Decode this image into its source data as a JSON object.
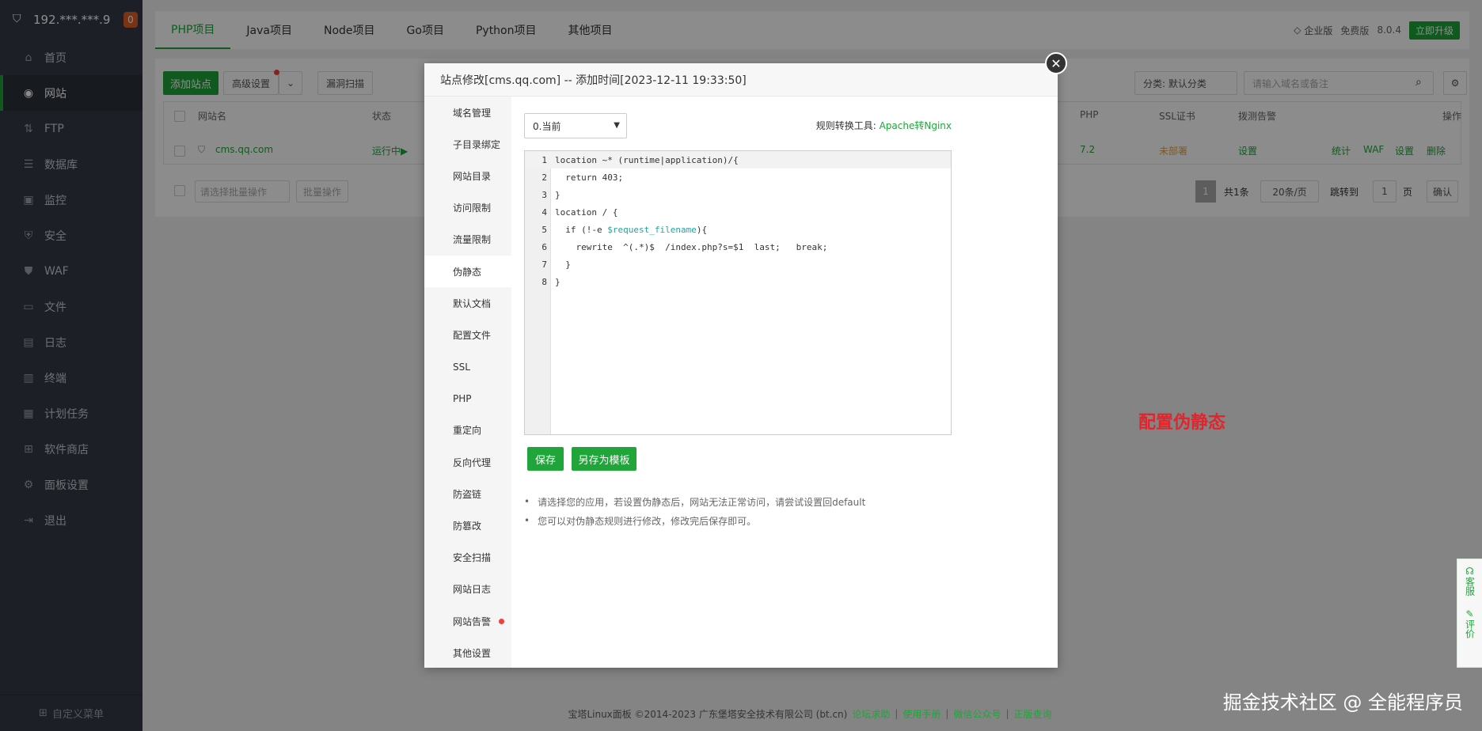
{
  "sidebar": {
    "host": "192.***.***.9",
    "badge": "0",
    "items": [
      {
        "label": "首页",
        "icon": "home-icon"
      },
      {
        "label": "网站",
        "icon": "globe-icon"
      },
      {
        "label": "FTP",
        "icon": "ftp-icon"
      },
      {
        "label": "数据库",
        "icon": "database-icon"
      },
      {
        "label": "监控",
        "icon": "monitor-icon"
      },
      {
        "label": "安全",
        "icon": "security-icon"
      },
      {
        "label": "WAF",
        "icon": "waf-icon"
      },
      {
        "label": "文件",
        "icon": "folder-icon"
      },
      {
        "label": "日志",
        "icon": "log-icon"
      },
      {
        "label": "终端",
        "icon": "terminal-icon"
      },
      {
        "label": "计划任务",
        "icon": "calendar-icon"
      },
      {
        "label": "软件商店",
        "icon": "store-icon"
      },
      {
        "label": "面板设置",
        "icon": "settings-icon"
      },
      {
        "label": "退出",
        "icon": "logout-icon"
      }
    ],
    "custom_menu": "自定义菜单"
  },
  "topbar": {
    "tabs": [
      "PHP项目",
      "Java项目",
      "Node项目",
      "Go项目",
      "Python项目",
      "其他项目"
    ],
    "enterprise": "企业版",
    "free": "免费版",
    "version": "8.0.4",
    "upgrade": "立即升级"
  },
  "panel": {
    "add_site": "添加站点",
    "advanced": "高级设置",
    "scan": "漏洞扫描",
    "category": "分类: 默认分类",
    "search_placeholder": "请输入域名或备注",
    "columns": {
      "name": "网站名",
      "status": "状态",
      "php": "PHP",
      "ssl": "SSL证书",
      "alert": "拨测告警",
      "ops": "操作"
    },
    "row": {
      "name": "cms.qq.com",
      "status": "运行中▶",
      "php": "7.2",
      "ssl": "未部署",
      "alert": "设置",
      "op1": "统计",
      "op2": "WAF",
      "op3": "设置",
      "op4": "删除"
    },
    "batch_placeholder": "请选择批量操作",
    "batch_btn": "批量操作",
    "page_num": "1",
    "total": "共1条",
    "per_page": "20条/页",
    "jump_to": "跳转到",
    "jump_val": "1",
    "page_unit": "页",
    "confirm": "确认"
  },
  "modal": {
    "title": "站点修改[cms.qq.com] -- 添加时间[2023-12-11 19:33:50]",
    "side": [
      "域名管理",
      "子目录绑定",
      "网站目录",
      "访问限制",
      "流量限制",
      "伪静态",
      "默认文档",
      "配置文件",
      "SSL",
      "PHP",
      "重定向",
      "反向代理",
      "防盗链",
      "防篡改",
      "安全扫描",
      "网站日志",
      "网站告警",
      "其他设置"
    ],
    "select_value": "0.当前",
    "convert_label": "规则转换工具:",
    "convert_link": "Apache转Nginx",
    "save": "保存",
    "save_template": "另存为模板",
    "tips": [
      "请选择您的应用，若设置伪静态后，网站无法正常访问，请尝试设置回default",
      "您可以对伪静态规则进行修改，修改完后保存即可。"
    ]
  },
  "code": {
    "l1a": "location ~* (runtime|application)/{",
    "l2": "  return 403;",
    "l3": "}",
    "l4": "location / {",
    "l5a": "  if (!-e ",
    "l5b": "$request_filename",
    "l5c": "){",
    "l6": "    rewrite  ^(.*)$  /index.php?s=$1  last;   break;",
    "l7": "  }",
    "l8": "}"
  },
  "annotation": "配置伪静态",
  "footer": {
    "copyright": "宝塔Linux面板 ©2014-2023 广东堡塔安全技术有限公司 (bt.cn)",
    "links": [
      "论坛求助",
      "使用手册",
      "微信公众号",
      "正版查询"
    ]
  },
  "watermark": "掘金技术社区 @ 全能程序员",
  "kefu": {
    "service": "客服",
    "review": "评价"
  }
}
